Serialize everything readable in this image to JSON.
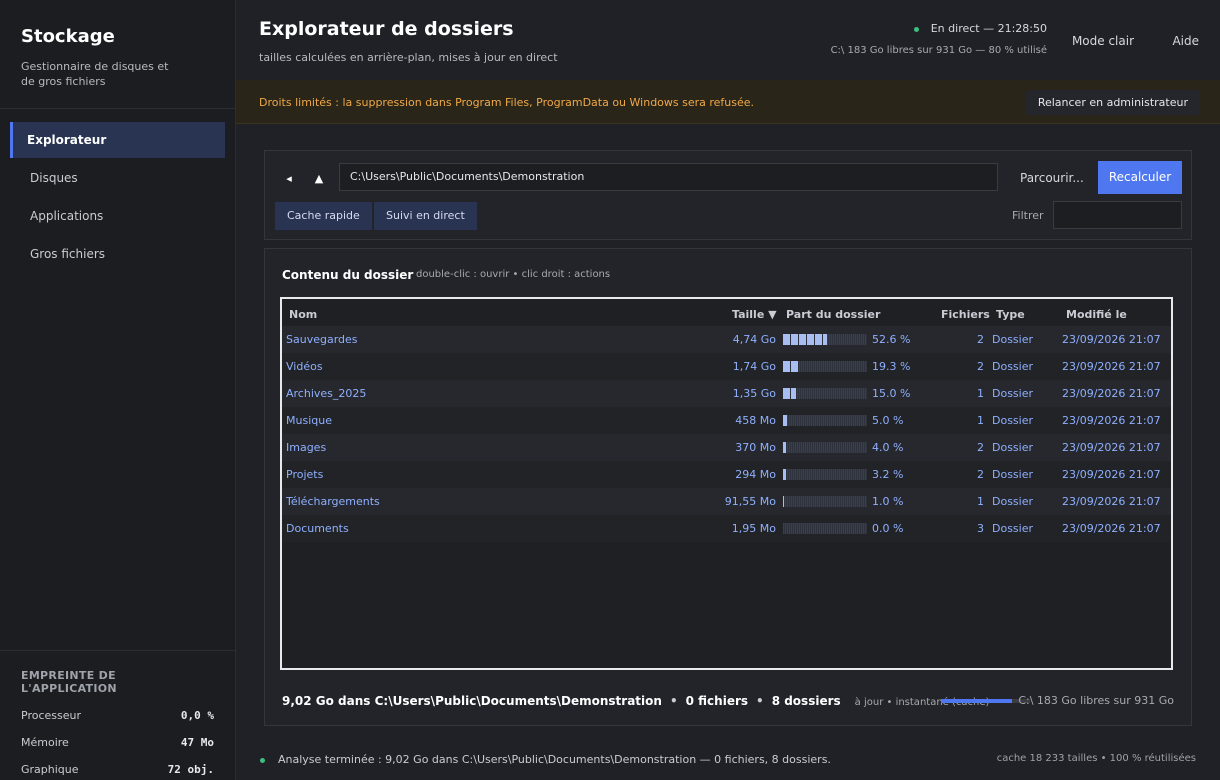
{
  "sidebar": {
    "title": "Stockage",
    "subtitle": "Gestionnaire de disques et de gros fichiers",
    "items": [
      {
        "label": "Explorateur",
        "active": true
      },
      {
        "label": "Disques",
        "active": false
      },
      {
        "label": "Applications",
        "active": false
      },
      {
        "label": "Gros fichiers",
        "active": false
      }
    ],
    "footprint": {
      "title": "EMPREINTE DE L'APPLICATION",
      "rows": [
        {
          "label": "Processeur",
          "value": "0,0 %"
        },
        {
          "label": "Mémoire",
          "value": "47 Mo"
        },
        {
          "label": "Graphique",
          "value": "72 obj."
        }
      ]
    }
  },
  "header": {
    "title": "Explorateur de dossiers",
    "subtitle": "tailles calculées en arrière-plan, mises à jour en direct",
    "live_text": "En direct — 21:28:50",
    "disk_text": "C:\\ 183 Go libres sur 931 Go — 80 % utilisé",
    "mode_label": "Mode clair",
    "help_label": "Aide",
    "live_color": "#3fbf7f"
  },
  "banner": {
    "text": "Droits limités : la suppression dans Program Files, ProgramData ou Windows sera refusée.",
    "button_label": "Relancer en administrateur",
    "color": "#f0a848"
  },
  "toolbar": {
    "back_icon": "◂",
    "up_icon": "▲",
    "path": "C:\\Users\\Public\\Documents\\Demonstration",
    "browse_label": "Parcourir...",
    "recalc_label": "Recalculer",
    "quick_cache_label": "Cache rapide",
    "live_follow_label": "Suivi en direct",
    "filter_label": "Filtrer",
    "filter_value": "",
    "accent": "#4f78f0"
  },
  "content": {
    "title": "Contenu du dossier",
    "hint": "double-clic : ouvrir • clic droit : actions",
    "columns": {
      "name": "Nom",
      "size": "Taille ▼",
      "share": "Part du dossier",
      "files": "Fichiers",
      "type": "Type",
      "modified": "Modifié le"
    },
    "rows": [
      {
        "name": "Sauvegardes",
        "size": "4,74 Go",
        "share": 52.6,
        "share_label": "52.6 %",
        "files": "2",
        "type": "Dossier",
        "modified": "23/09/2026 21:07"
      },
      {
        "name": "Vidéos",
        "size": "1,74 Go",
        "share": 19.3,
        "share_label": "19.3 %",
        "files": "2",
        "type": "Dossier",
        "modified": "23/09/2026 21:07"
      },
      {
        "name": "Archives_2025",
        "size": "1,35 Go",
        "share": 15.0,
        "share_label": "15.0 %",
        "files": "1",
        "type": "Dossier",
        "modified": "23/09/2026 21:07"
      },
      {
        "name": "Musique",
        "size": "458 Mo",
        "share": 5.0,
        "share_label": "5.0 %",
        "files": "1",
        "type": "Dossier",
        "modified": "23/09/2026 21:07"
      },
      {
        "name": "Images",
        "size": "370 Mo",
        "share": 4.0,
        "share_label": "4.0 %",
        "files": "2",
        "type": "Dossier",
        "modified": "23/09/2026 21:07"
      },
      {
        "name": "Projets",
        "size": "294 Mo",
        "share": 3.2,
        "share_label": "3.2 %",
        "files": "2",
        "type": "Dossier",
        "modified": "23/09/2026 21:07"
      },
      {
        "name": "Téléchargements",
        "size": "91,55 Mo",
        "share": 1.0,
        "share_label": "1.0 %",
        "files": "1",
        "type": "Dossier",
        "modified": "23/09/2026 21:07"
      },
      {
        "name": "Documents",
        "size": "1,95 Mo",
        "share": 0.0,
        "share_label": "0.0 %",
        "files": "3",
        "type": "Dossier",
        "modified": "23/09/2026 21:07"
      }
    ],
    "summary": {
      "total": "9,02 Go dans C:\\Users\\Public\\Documents\\Demonstration",
      "files": "0 fichiers",
      "folders": "8 dossiers",
      "state": "à jour • instantané (cache)",
      "disk_used_fraction": 0.8,
      "free": "C:\\ 183 Go libres sur 931 Go"
    }
  },
  "statusbar": {
    "message": "Analyse terminée : 9,02 Go dans C:\\Users\\Public\\Documents\\Demonstration — 0 fichiers, 8 dossiers.",
    "cache": "cache 18 233 tailles • 100 % réutilisées"
  }
}
